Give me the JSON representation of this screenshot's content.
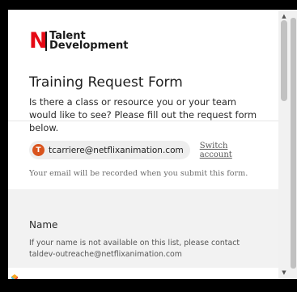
{
  "brand": {
    "logo_letter": "N",
    "logo_line1": "Talent",
    "logo_line2": "Development",
    "accent_color": "#e50914"
  },
  "form": {
    "title": "Training Request Form",
    "description": "Is there a class or resource you or your team would like to see? Please fill out the request form below."
  },
  "account": {
    "avatar_initial": "T",
    "email": "tcarriere@netflixanimation.com",
    "switch_label": "Switch account",
    "note": "Your email will be recorded when you submit this form."
  },
  "question": {
    "title": "Name",
    "help": "If your name is not available on this list, please contact taldev-outreache@netflixanimation.com"
  },
  "footer": {
    "icon": "forms-app-icon"
  },
  "scrollbar": {
    "up": "▲",
    "down": "▼"
  }
}
